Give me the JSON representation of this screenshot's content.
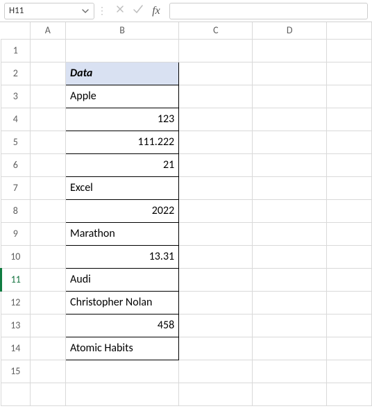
{
  "formula_bar": {
    "cell_reference": "H11",
    "formula_value": ""
  },
  "columns": [
    "A",
    "B",
    "C",
    "D",
    ""
  ],
  "rows": [
    {
      "num": "1"
    },
    {
      "num": "2",
      "bValue": "Data",
      "bClass": "left data-cell data-header"
    },
    {
      "num": "3",
      "bValue": "Apple",
      "bClass": "left data-cell"
    },
    {
      "num": "4",
      "bValue": "123",
      "bClass": "right data-cell"
    },
    {
      "num": "5",
      "bValue": "111.222",
      "bClass": "right data-cell"
    },
    {
      "num": "6",
      "bValue": "21",
      "bClass": "right data-cell"
    },
    {
      "num": "7",
      "bValue": "Excel",
      "bClass": "left data-cell"
    },
    {
      "num": "8",
      "bValue": "2022",
      "bClass": "right data-cell"
    },
    {
      "num": "9",
      "bValue": "Marathon",
      "bClass": "left data-cell"
    },
    {
      "num": "10",
      "bValue": "13.31",
      "bClass": "right data-cell"
    },
    {
      "num": "11",
      "bValue": "Audi",
      "bClass": "left data-cell",
      "active": true
    },
    {
      "num": "12",
      "bValue": "Christopher Nolan",
      "bClass": "left data-cell"
    },
    {
      "num": "13",
      "bValue": "458",
      "bClass": "right data-cell"
    },
    {
      "num": "14",
      "bValue": "Atomic Habits",
      "bClass": "left data-cell"
    },
    {
      "num": "15"
    },
    {
      "num": ""
    }
  ],
  "fx_label": "fx"
}
